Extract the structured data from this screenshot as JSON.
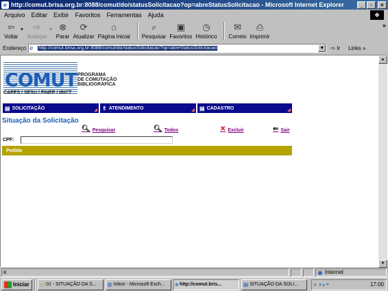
{
  "window": {
    "title": "http://comut.brisa.org.br:8088/comut/do/statusSolicitacao?op=abreStatusSolicitacao - Microsoft Internet Explorer",
    "minimize": "_",
    "maximize": "▫",
    "close": "×"
  },
  "menu": [
    "Arquivo",
    "Editar",
    "Exibir",
    "Favoritos",
    "Ferramentas",
    "Ajuda"
  ],
  "toolbar": {
    "back": "Voltar",
    "forward": "Avançar",
    "stop": "Parar",
    "refresh": "Atualizar",
    "home": "Página inicial",
    "search": "Pesquisar",
    "favorites": "Favoritos",
    "history": "Histórico",
    "mail": "Correio",
    "print": "Imprimir"
  },
  "address": {
    "label": "Endereço",
    "url": "http://comut.brisa.org.br:8088/comut/do/statusSolicitacao?op=abreStatusSolicitacao",
    "go": "Ir",
    "links": "Links"
  },
  "page": {
    "logo_word": "COMUT",
    "program_lines": [
      "PROGRAMA",
      "DE COMUTAÇÃO",
      "BIBLIOGRÁFICA"
    ],
    "logo_sub": "CAPES / SESU / FINEP / IBICT",
    "nav": [
      "SOLICITAÇÃO",
      "ATENDIMENTO",
      "CADASTRO"
    ],
    "heading": "Situação da Solicitação",
    "actions": {
      "search": "Pesquisar",
      "all": "Todos",
      "delete": "Excluir",
      "exit": "Sair"
    },
    "cpf_label": "CPF:",
    "cpf_value": "",
    "pedido_header": "Pedido"
  },
  "status": {
    "zone": "Internet"
  },
  "taskbar": {
    "start": "Iniciar",
    "tasks": [
      "01 - SITUAÇÃO DA S...",
      "Inbox - Microsoft Exch...",
      "http://comut.bris...",
      "SITUAÇÃO DA SOLI..."
    ],
    "clock": "17:00"
  }
}
